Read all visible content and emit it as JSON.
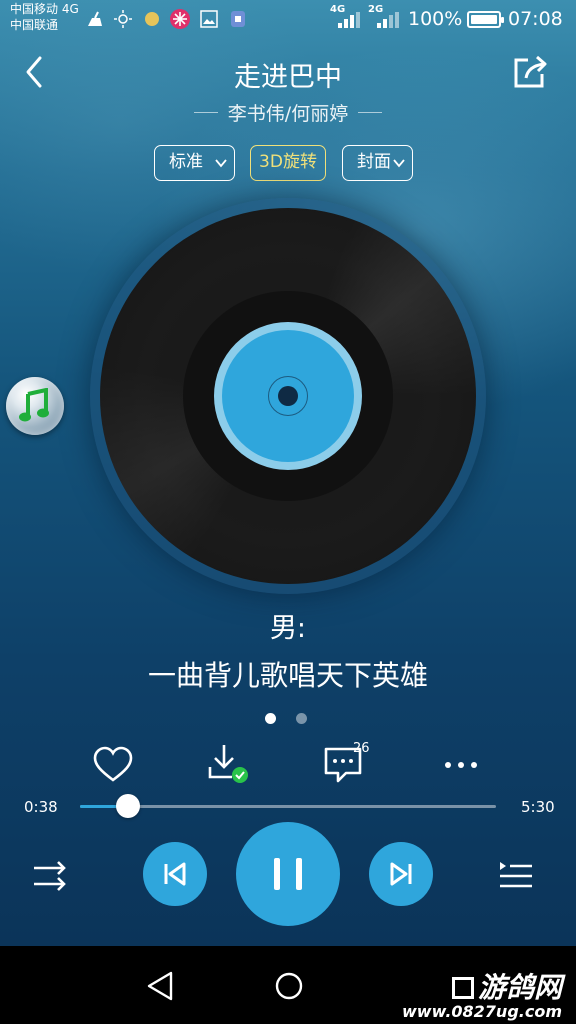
{
  "status_bar": {
    "carrier1": "中国移动 4G",
    "carrier2": "中国联通",
    "net1": "4G",
    "net2": "2G",
    "battery": "100%",
    "time": "07:08"
  },
  "header": {
    "title": "走进巴中",
    "artist": "李书伟/何丽婷"
  },
  "modes": {
    "standard": "标准",
    "rotate": "3D旋转",
    "cover": "封面"
  },
  "lyrics": {
    "speaker": "男:",
    "line": "一曲背儿歌唱天下英雄"
  },
  "actions": {
    "comment_count": "26"
  },
  "progress": {
    "current": "0:38",
    "total": "5:30",
    "fraction": 0.115
  },
  "watermark": {
    "brand": "游鸽网",
    "url": "www.0827ug.com"
  },
  "colors": {
    "accent": "#2fa6dc",
    "active_mode": "#f1e17a"
  },
  "icons": [
    "back-icon",
    "share-icon",
    "heart-icon",
    "download-icon",
    "comment-icon",
    "more-icon",
    "shuffle-icon",
    "previous-icon",
    "pause-icon",
    "next-icon",
    "playlist-icon",
    "music-note-icon"
  ]
}
